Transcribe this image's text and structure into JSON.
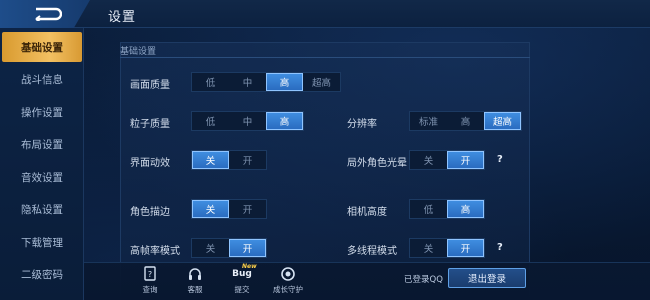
{
  "header": {
    "title": "设置"
  },
  "sidebar": {
    "items": [
      {
        "label": "基础设置",
        "active": true
      },
      {
        "label": "战斗信息",
        "active": false
      },
      {
        "label": "操作设置",
        "active": false
      },
      {
        "label": "布局设置",
        "active": false
      },
      {
        "label": "音效设置",
        "active": false
      },
      {
        "label": "隐私设置",
        "active": false
      },
      {
        "label": "下载管理",
        "active": false
      },
      {
        "label": "二级密码",
        "active": false
      }
    ]
  },
  "main": {
    "section_title": "基础设置",
    "settings": {
      "graphics_quality": {
        "label": "画面质量",
        "options": [
          "低",
          "中",
          "高",
          "超高"
        ],
        "selected": "高"
      },
      "particle_quality": {
        "label": "粒子质量",
        "options": [
          "低",
          "中",
          "高"
        ],
        "selected": "高"
      },
      "resolution": {
        "label": "分辨率",
        "options": [
          "标准",
          "高",
          "超高"
        ],
        "selected": "超高"
      },
      "ui_animation": {
        "label": "界面动效",
        "options": [
          "关",
          "开"
        ],
        "selected": "关"
      },
      "outer_glow": {
        "label": "局外角色光晕",
        "options": [
          "关",
          "开"
        ],
        "selected": "开",
        "help": "?"
      },
      "character_outline": {
        "label": "角色描边",
        "options": [
          "关",
          "开"
        ],
        "selected": "关"
      },
      "camera_height": {
        "label": "相机高度",
        "options": [
          "低",
          "高"
        ],
        "selected": "高"
      },
      "high_framerate": {
        "label": "高帧率模式",
        "options": [
          "关",
          "开"
        ],
        "selected": "开"
      },
      "multithread": {
        "label": "多线程模式",
        "options": [
          "关",
          "开"
        ],
        "selected": "开",
        "help": "?"
      }
    }
  },
  "footer": {
    "buttons": [
      {
        "label": "查询",
        "icon": "query-icon"
      },
      {
        "label": "客服",
        "icon": "headset-icon"
      },
      {
        "label": "提交",
        "icon": "bug-icon",
        "icon_text": "Bug",
        "badge": "New"
      },
      {
        "label": "成长守护",
        "icon": "shield-icon"
      }
    ],
    "login_status": "已登录QQ",
    "logout_label": "退出登录"
  },
  "colors": {
    "active_tab": "#f2c062",
    "selected_option": "#2f78d0",
    "background": "#0a1a33"
  }
}
